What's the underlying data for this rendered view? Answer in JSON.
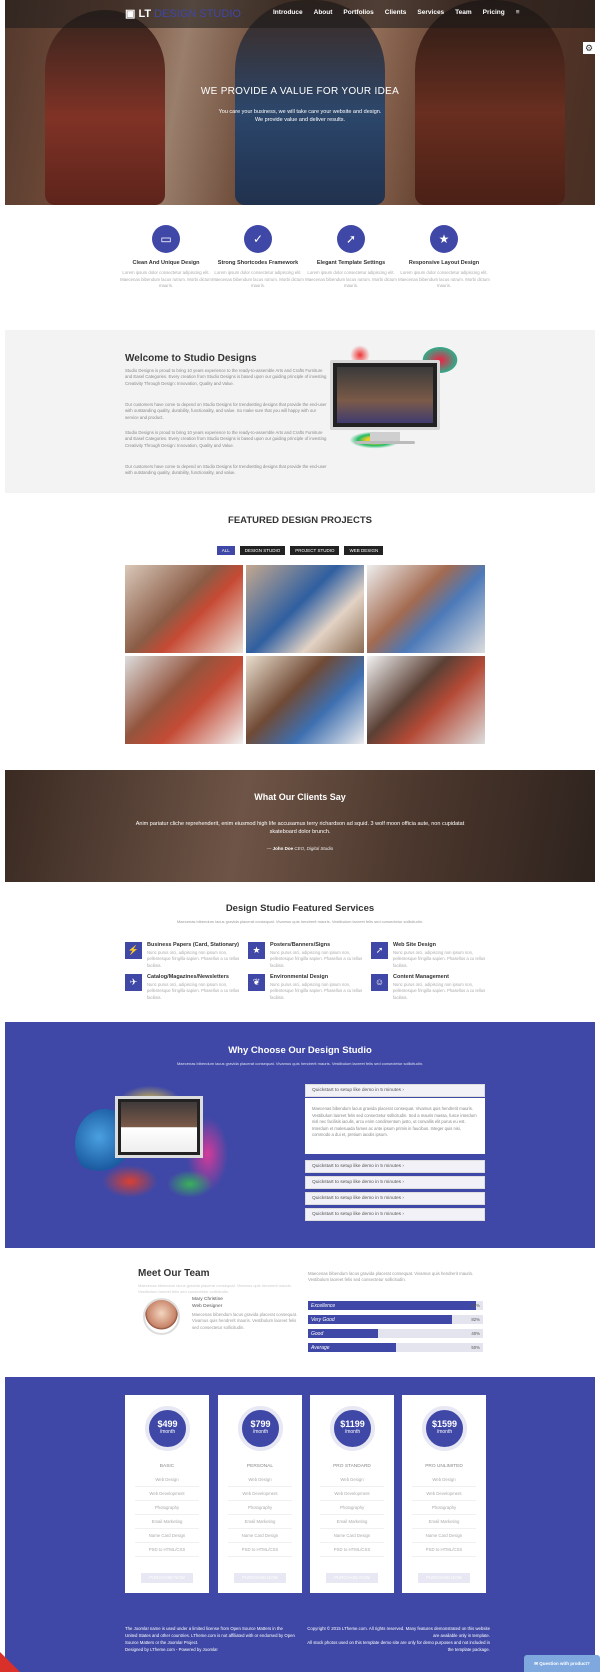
{
  "header": {
    "logo_lt": "LT",
    "logo_ds": "DESIGN STUDIO",
    "nav": [
      "Introduce",
      "About",
      "Portfolios",
      "Clients",
      "Services",
      "Team",
      "Pricing"
    ],
    "menu_icon": "≡",
    "settings_icon": "⚙"
  },
  "hero": {
    "title": "WE PROVIDE A VALUE FOR YOUR IDEA",
    "line1": "You care your business, we will take care your website and design.",
    "line2": "We provide value and deliver results."
  },
  "features": [
    {
      "icon": "monitor-icon",
      "glyph": "▭",
      "title": "Clean And Unique Design",
      "text": "Lorem ipsum dolor consectetur adipiscing elit. Maecenas bibendum lacus rutrum. Morbi dictum mauris."
    },
    {
      "icon": "check-icon",
      "glyph": "✓",
      "title": "Strong Shortcodes Framework",
      "text": "Lorem ipsum dolor consectetur adipiscing elit. Maecenas bibendum lacus rutrum. Morbi dictum mauris."
    },
    {
      "icon": "rocket-icon",
      "glyph": "➚",
      "title": "Elegant Template Settings",
      "text": "Lorem ipsum dolor consectetur adipiscing elit. Maecenas bibendum lacus rutrum. Morbi dictum mauris."
    },
    {
      "icon": "star-icon",
      "glyph": "★",
      "title": "Responsive Layout Design",
      "text": "Lorem ipsum dolor consectetur adipiscing elit. Maecenas bibendum lacus rutrum. Morbi dictum mauris."
    }
  ],
  "welcome": {
    "title": "Welcome to Studio Designs",
    "p1": "Studio Designs is proud to bring 10 years experience to the ready-to-assemble Arts and Crafts Furniture and Easel Categories. Every creation from Studio Designs is based upon our guiding principle of investing Creativity Through Design: Innovation, Quality and Value.",
    "p2": "Our customers have come to depend on Studio Designs for trendsetting designs that provide the end-user with outstanding quality, durability, functionality, and value. So make sure that you will happy with our service and product.",
    "p3": "Studio Designs is proud to bring 10 years experience to the ready-to-assemble Arts and Crafts Furniture and Easel Categories. Every creation from Studio Designs is based upon our guiding principle of investing Creativity Through Design: Innovation, Quality and Value.",
    "p4": "Our customers have come to depend on Studio Designs for trendsetting designs that provide the end-user with outstanding quality, durability, functionality, and value."
  },
  "projects": {
    "title": "FEATURED DESIGN PROJECTS",
    "filters": [
      "ALL",
      "DESIGN STUDIO",
      "PROJECT STUDIO",
      "WEB DESIGN"
    ]
  },
  "testimonial": {
    "title": "What Our Clients Say",
    "quote": "Anim pariatur cliche reprehenderit, enim eiusmod high life accusamus terry richardson ad squid. 3 wolf moon officia aute, non cupidatat skateboard dolor brunch.",
    "author": "John Doe",
    "role": "CEO, Digital Studio"
  },
  "services": {
    "title": "Design Studio Featured Services",
    "subtitle": "Maecenas bibendum lacus gravida placerat consequat. Vivamus quis hendrerit mauris. Vestibulum laoreet felis sed consectetur sollicitudin.",
    "items": [
      {
        "icon": "flash-icon",
        "glyph": "⚡",
        "title": "Business Papers (Card, Stationary)",
        "text": "Nunc purus orci, adipiscing non ipsum non, pellentesque fringilla sapien. Phasellus a cu tellus facilisis."
      },
      {
        "icon": "star-icon",
        "glyph": "★",
        "title": "Posters/Banners/Signs",
        "text": "Nunc purus orci, adipiscing non ipsum non, pellentesque fringilla sapien. Phasellus a cu tellus facilisis."
      },
      {
        "icon": "rocket-icon",
        "glyph": "➚",
        "title": "Web Site Design",
        "text": "Nunc purus orci, adipiscing non ipsum non, pellentesque fringilla sapien. Phasellus a cu tellus facilisis."
      },
      {
        "icon": "plane-icon",
        "glyph": "✈",
        "title": "Catalog/Magazines/Newsletters",
        "text": "Nunc purus orci, adipiscing non ipsum non, pellentesque fringilla sapien. Phasellus a cu tellus facilisis."
      },
      {
        "icon": "leaf-icon",
        "glyph": "❦",
        "title": "Environmental Design",
        "text": "Nunc purus orci, adipiscing non ipsum non, pellentesque fringilla sapien. Phasellus a cu tellus facilisis."
      },
      {
        "icon": "users-icon",
        "glyph": "☺",
        "title": "Content Management",
        "text": "Nunc purus orci, adipiscing non ipsum non, pellentesque fringilla sapien. Phasellus a cu tellus facilisis."
      }
    ]
  },
  "why": {
    "title": "Why Choose Our Design Studio",
    "subtitle": "Maecenas bibendum lacus gravida placerat consequat. Vivamus quis hendrerit mauris. Vestibulum laoreet felis sed consectetur sollicitudin.",
    "accordion": [
      "Quickstart to setup like demo in 5 minutes",
      "Quickstart to setup like demo in 5 minutes",
      "Quickstart to setup like demo in 5 minutes",
      "Quickstart to setup like demo in 5 minutes",
      "Quickstart to setup like demo in 5 minutes"
    ],
    "open_body": "Maecenas bibendum lacus gravida placerat consequat. Vivamus quis hendrerit mauris. Vestibulum laoreet felis sed consectetur sollicitudin. Sed a mauris massa, fusce interdum nisl nec facilisis iaculis, arcu enim condimentum justo, ut convallis elit purus eu est. Interdum et malesuada fames ac ante ipsum primis in faucibus. Integer quis nisi, commodo a dui et, pretium iaculis ipsum."
  },
  "team": {
    "title": "Meet Our Team",
    "lead": "Maecenas bibendum lacus gravida placerat consequat. Vivamus quis hendrerit mauris. Vestibulum laoreet felis sed consectetur sollicitudin.",
    "name": "Mary Christine",
    "role": "Web Designer",
    "bio": "Maecenas bibendum lacus gravida placerat consequat. Vivamus quis hendrerit mauris. Vestibulum laoreet felis sed consectetur sollicitudin.",
    "skills_intro": "Maecenas bibendum lacus gravida placerat consequat. Vivamus quis hendrerit mauris. Vestibulum laoreet felis sed consectetur sollicitudin.",
    "skills": [
      {
        "label": "Excellence",
        "percent": "96%",
        "value": 0.96
      },
      {
        "label": "Very Good",
        "percent": "82%",
        "value": 0.82
      },
      {
        "label": "Good",
        "percent": "40%",
        "value": 0.4
      },
      {
        "label": "Average",
        "percent": "50%",
        "value": 0.5
      }
    ]
  },
  "pricing": {
    "per": "/month",
    "features": [
      "Web Design",
      "Web Development",
      "Photography",
      "Email Marketing",
      "Name Card Design",
      "PSD to HTML/CSS"
    ],
    "buy_label": "PURCHASE NOW",
    "plans": [
      {
        "price": "$499",
        "name": "BASIC"
      },
      {
        "price": "$799",
        "name": "PERSONAL"
      },
      {
        "price": "$1199",
        "name": "PRO STANDARD"
      },
      {
        "price": "$1599",
        "name": "PRO UNLIMITED"
      }
    ]
  },
  "footer": {
    "left": "The Joomla! name is used under a limited license from Open Source Matters in the United States and other countries. LTheme.com is not affiliated with or endorsed by Open Source Matters or the Joomla! Project.",
    "credit": "Designed by LTheme.com - Powered by Joomla!",
    "right": "Copyright © 2015 LTheme.com. All rights reserved. Many features demonstrated on this website are available only in template.",
    "right2": "All stock photos used on this template demo site are only for demo purposes and not included in the template package.",
    "question_btn": "Question with product?"
  }
}
